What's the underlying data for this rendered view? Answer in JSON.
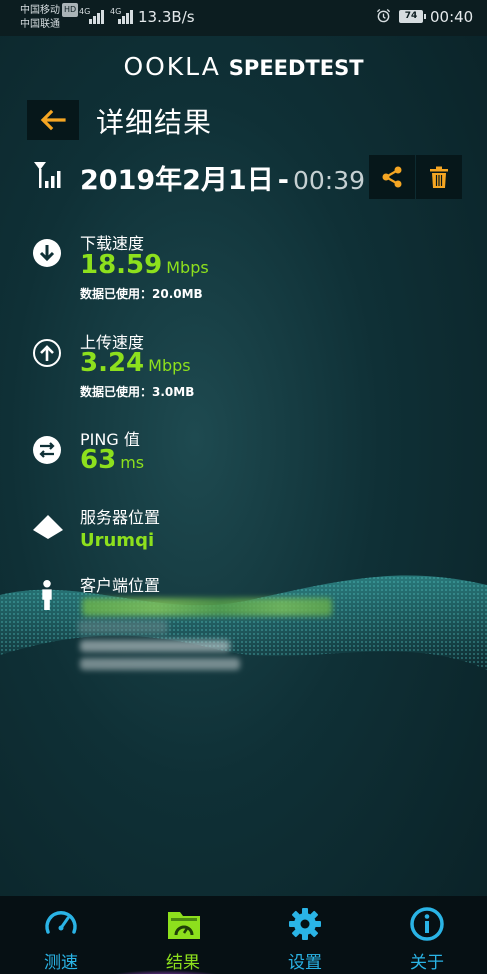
{
  "status_bar": {
    "carrier1": "中国移动",
    "carrier1_badge": "HD",
    "carrier2": "中国联通",
    "network1": "4G",
    "network2": "4G",
    "speed": "13.3B/s",
    "battery": "74",
    "time": "00:40"
  },
  "brand": {
    "ookla": "OOKLA",
    "speedtest": "SPEEDTEST"
  },
  "header": {
    "title": "详细结果"
  },
  "result": {
    "date": "2019年2月1日",
    "dash": "-",
    "time": "00:39"
  },
  "download": {
    "label": "下载速度",
    "value": "18.59",
    "unit": "Mbps",
    "used": "数据已使用：20.0MB"
  },
  "upload": {
    "label": "上传速度",
    "value": "3.24",
    "unit": "Mbps",
    "used": "数据已使用：3.0MB"
  },
  "ping": {
    "label": "PING 值",
    "value": "63",
    "unit": "ms"
  },
  "server": {
    "label": "服务器位置",
    "value": "Urumqi"
  },
  "client": {
    "label": "客户端位置"
  },
  "nav": {
    "items": [
      {
        "label": "测速",
        "icon": "speedometer-icon"
      },
      {
        "label": "结果",
        "icon": "results-folder-icon"
      },
      {
        "label": "设置",
        "icon": "gear-icon"
      },
      {
        "label": "关于",
        "icon": "info-icon"
      }
    ]
  },
  "colors": {
    "accent_green": "#8de01d",
    "accent_orange": "#f5a623",
    "nav_blue": "#2ab4e6",
    "background": "#0f3036"
  }
}
